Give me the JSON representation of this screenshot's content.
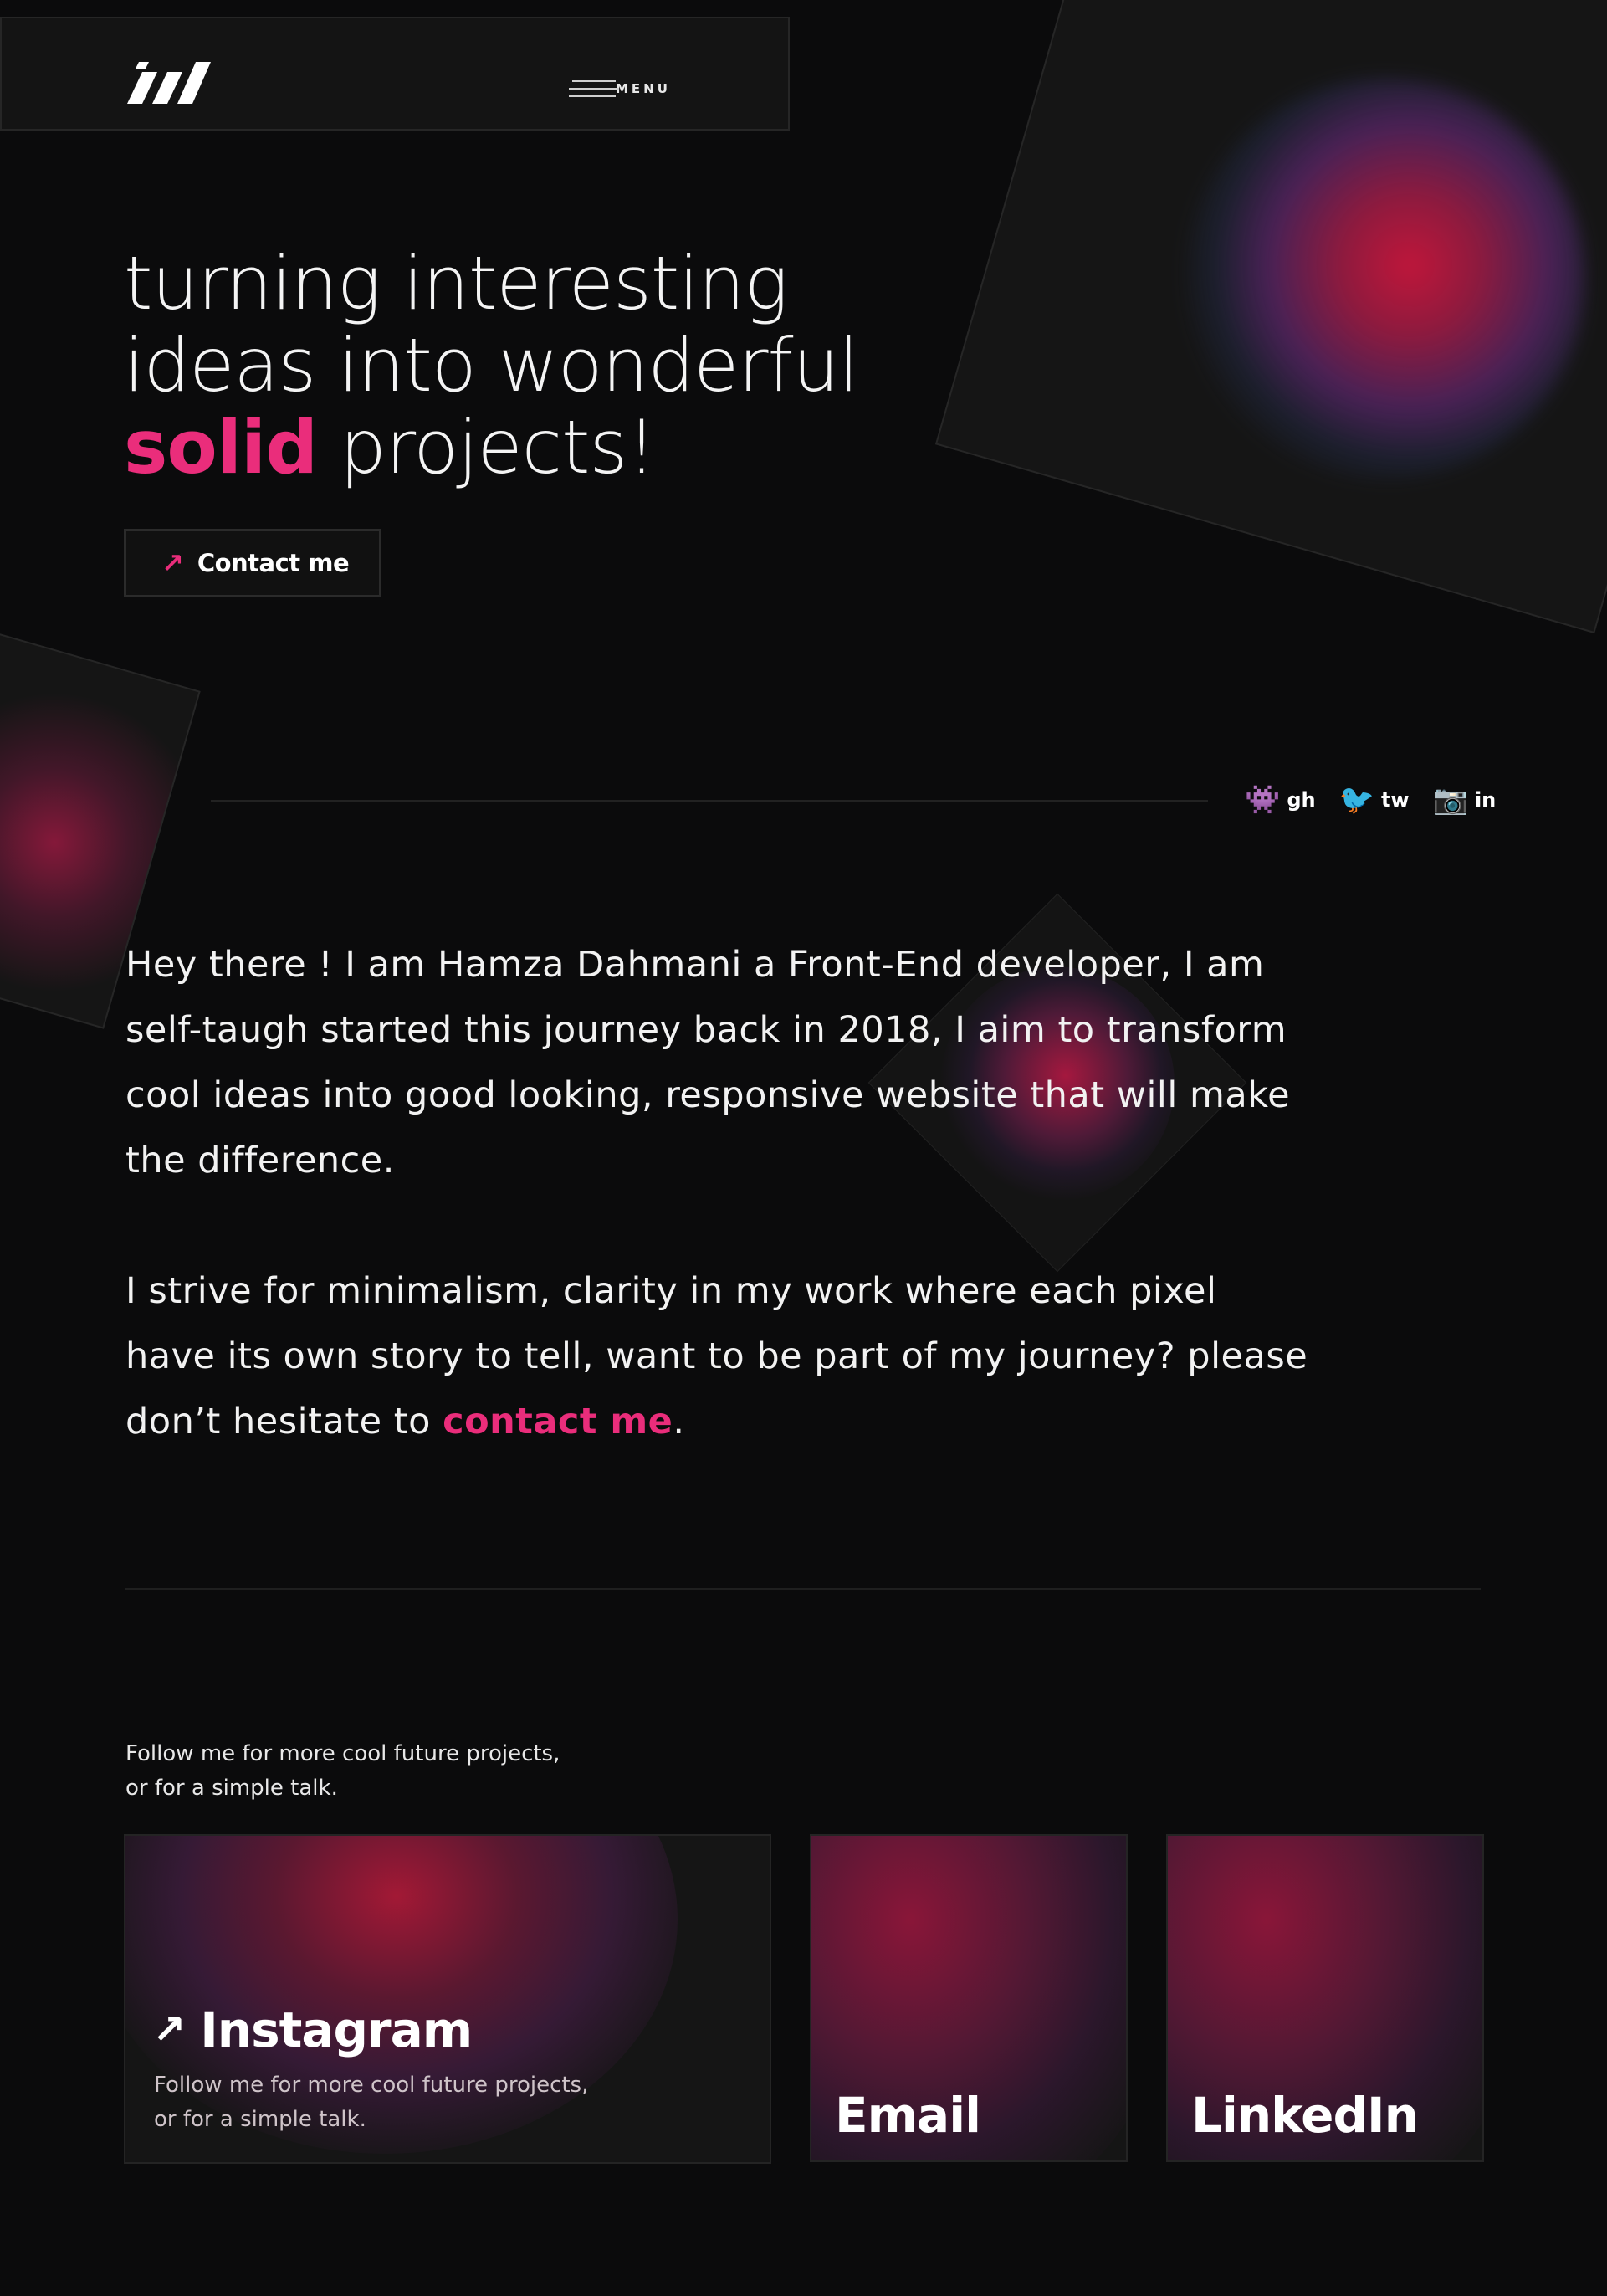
{
  "header": {
    "logo_alt": "logo",
    "menu_label": "MENU"
  },
  "hero": {
    "title_line1": "turning interesting",
    "title_line2": "ideas into wonderful",
    "title_accent": "solid",
    "title_rest": " projects!",
    "contact_button": {
      "arrow": "↗",
      "label": "Contact me"
    }
  },
  "socials": [
    {
      "icon": "alien-monster-icon",
      "emoji": "👾",
      "label": "gh"
    },
    {
      "icon": "bird-icon",
      "emoji": "🐦",
      "label": "tw"
    },
    {
      "icon": "camera-icon",
      "emoji": "📷",
      "label": "in"
    }
  ],
  "about": {
    "paragraph1": "Hey there ! I am Hamza Dahmani a Front-End developer, I am self-taugh started this journey back in 2018, I aim to transform cool ideas into good looking, responsive website that will make the difference.",
    "paragraph2_before": "I strive for minimalism, clarity in my work where each pixel have its own story to tell, want to be part of my journey? please don’t hesitate to ",
    "paragraph2_link": "contact me",
    "paragraph2_after": "."
  },
  "follow": {
    "line1": "Follow me for more cool future projects,",
    "line2": "or for a simple talk."
  },
  "cards": {
    "instagram": {
      "arrow": "↗",
      "title": "Instagram",
      "desc_line1": "Follow me for more cool future projects,",
      "desc_line2": "or for a simple talk."
    },
    "email": {
      "title": "Email"
    },
    "linkedin": {
      "title": "LinkedIn"
    }
  },
  "colors": {
    "background": "#0b0b0c",
    "accent": "#ea2d7b",
    "panel": "#151515",
    "glow_red": "#c0163a"
  }
}
